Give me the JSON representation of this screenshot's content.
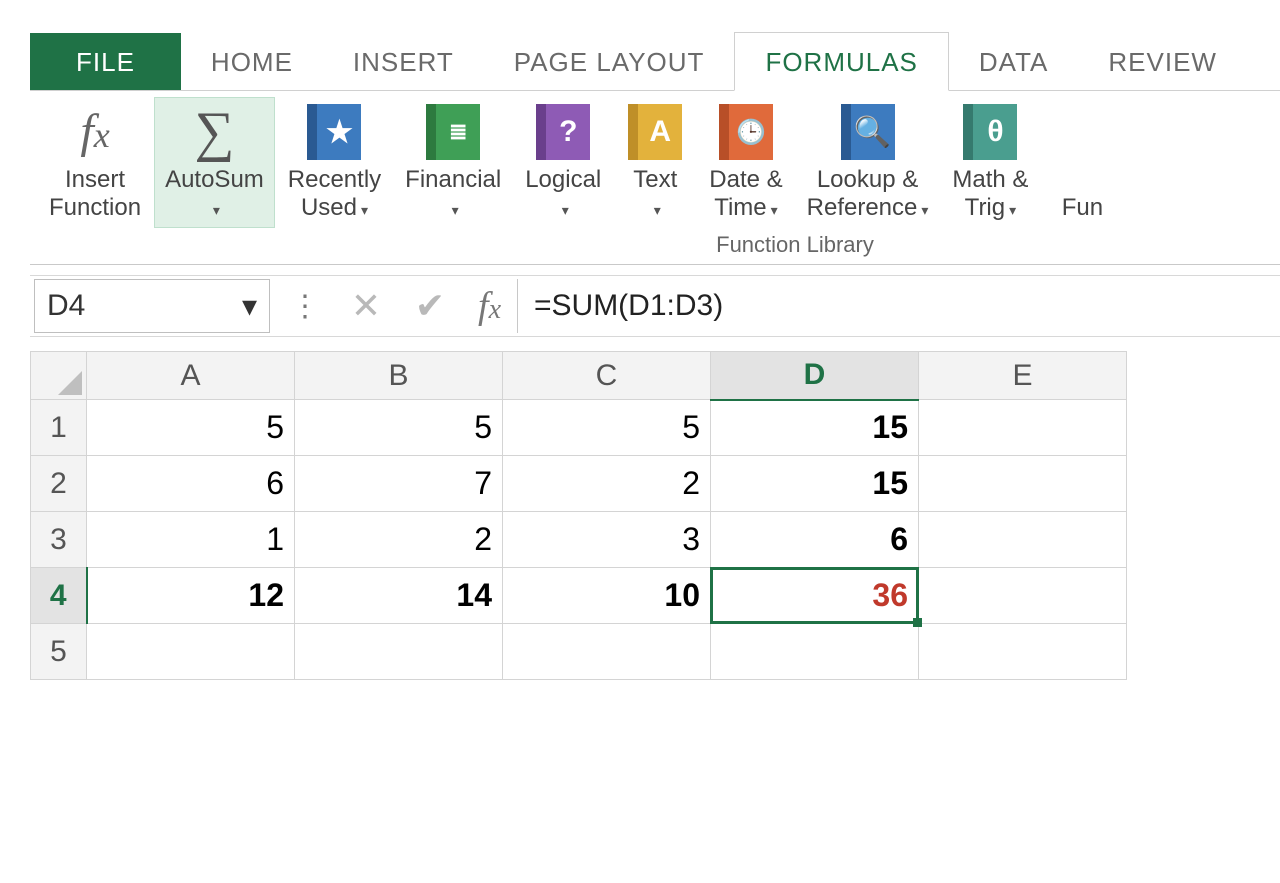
{
  "tabs": {
    "file": "FILE",
    "home": "HOME",
    "insert": "INSERT",
    "page_layout": "PAGE LAYOUT",
    "formulas": "FORMULAS",
    "data": "DATA",
    "review": "REVIEW"
  },
  "ribbon": {
    "group_caption": "Function Library",
    "insert_function": {
      "line1": "Insert",
      "line2": "Function"
    },
    "autosum": "AutoSum",
    "recently_used": {
      "line1": "Recently",
      "line2": "Used"
    },
    "financial": "Financial",
    "logical": "Logical",
    "text": "Text",
    "date_time": {
      "line1": "Date &",
      "line2": "Time"
    },
    "lookup_ref": {
      "line1": "Lookup &",
      "line2": "Reference"
    },
    "math_trig": {
      "line1": "Math &",
      "line2": "Trig"
    },
    "more_trunc": "Fun"
  },
  "colors": {
    "recently_used": "#3d7bbf",
    "financial": "#3f9f56",
    "logical": "#8e5bb5",
    "text": "#e3b23c",
    "date_time": "#e06a3b",
    "lookup_ref": "#3d7bbf",
    "math_trig": "#4a9e8f"
  },
  "editbar": {
    "namebox": "D4",
    "formula": "=SUM(D1:D3)"
  },
  "sheet": {
    "columns": [
      "A",
      "B",
      "C",
      "D",
      "E"
    ],
    "rows": [
      "1",
      "2",
      "3",
      "4",
      "5"
    ],
    "selected_col": "D",
    "selected_row": "4",
    "cells": {
      "A1": "5",
      "B1": "5",
      "C1": "5",
      "D1": "15",
      "A2": "6",
      "B2": "7",
      "C2": "2",
      "D2": "15",
      "A3": "1",
      "B3": "2",
      "C3": "3",
      "D3": "6",
      "A4": "12",
      "B4": "14",
      "C4": "10",
      "D4": "36"
    },
    "bold_cells": [
      "D1",
      "D2",
      "D3",
      "A4",
      "B4",
      "C4",
      "D4"
    ],
    "red_cells": [
      "D4"
    ]
  }
}
